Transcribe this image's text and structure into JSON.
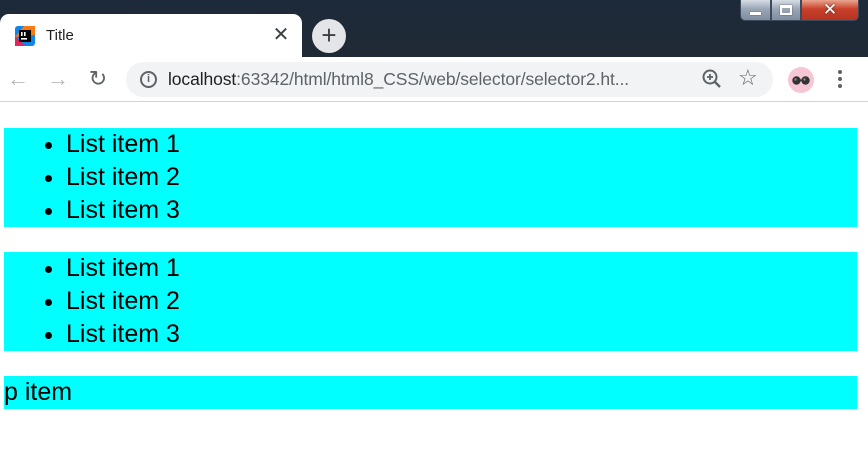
{
  "window": {
    "controls": [
      "minimize",
      "maximize",
      "close"
    ]
  },
  "tab": {
    "title": "Title",
    "favicon": "intellij-icon",
    "close_icon": "close-icon"
  },
  "toolbar": {
    "back_icon": "back-arrow-icon",
    "forward_icon": "forward-arrow-icon",
    "reload_icon": "reload-icon",
    "url_host": "localhost",
    "url_rest": ":63342/html/html8_CSS/web/selector/selector2.ht...",
    "info_icon": "i"
  },
  "page": {
    "lists": [
      {
        "items": [
          "List item 1",
          "List item 2",
          "List item 3"
        ]
      },
      {
        "items": [
          "List item 1",
          "List item 2",
          "List item 3"
        ]
      }
    ],
    "paragraph": "p item"
  },
  "colors": {
    "highlight": "#00ffff",
    "tab_strip": "#202a35"
  }
}
